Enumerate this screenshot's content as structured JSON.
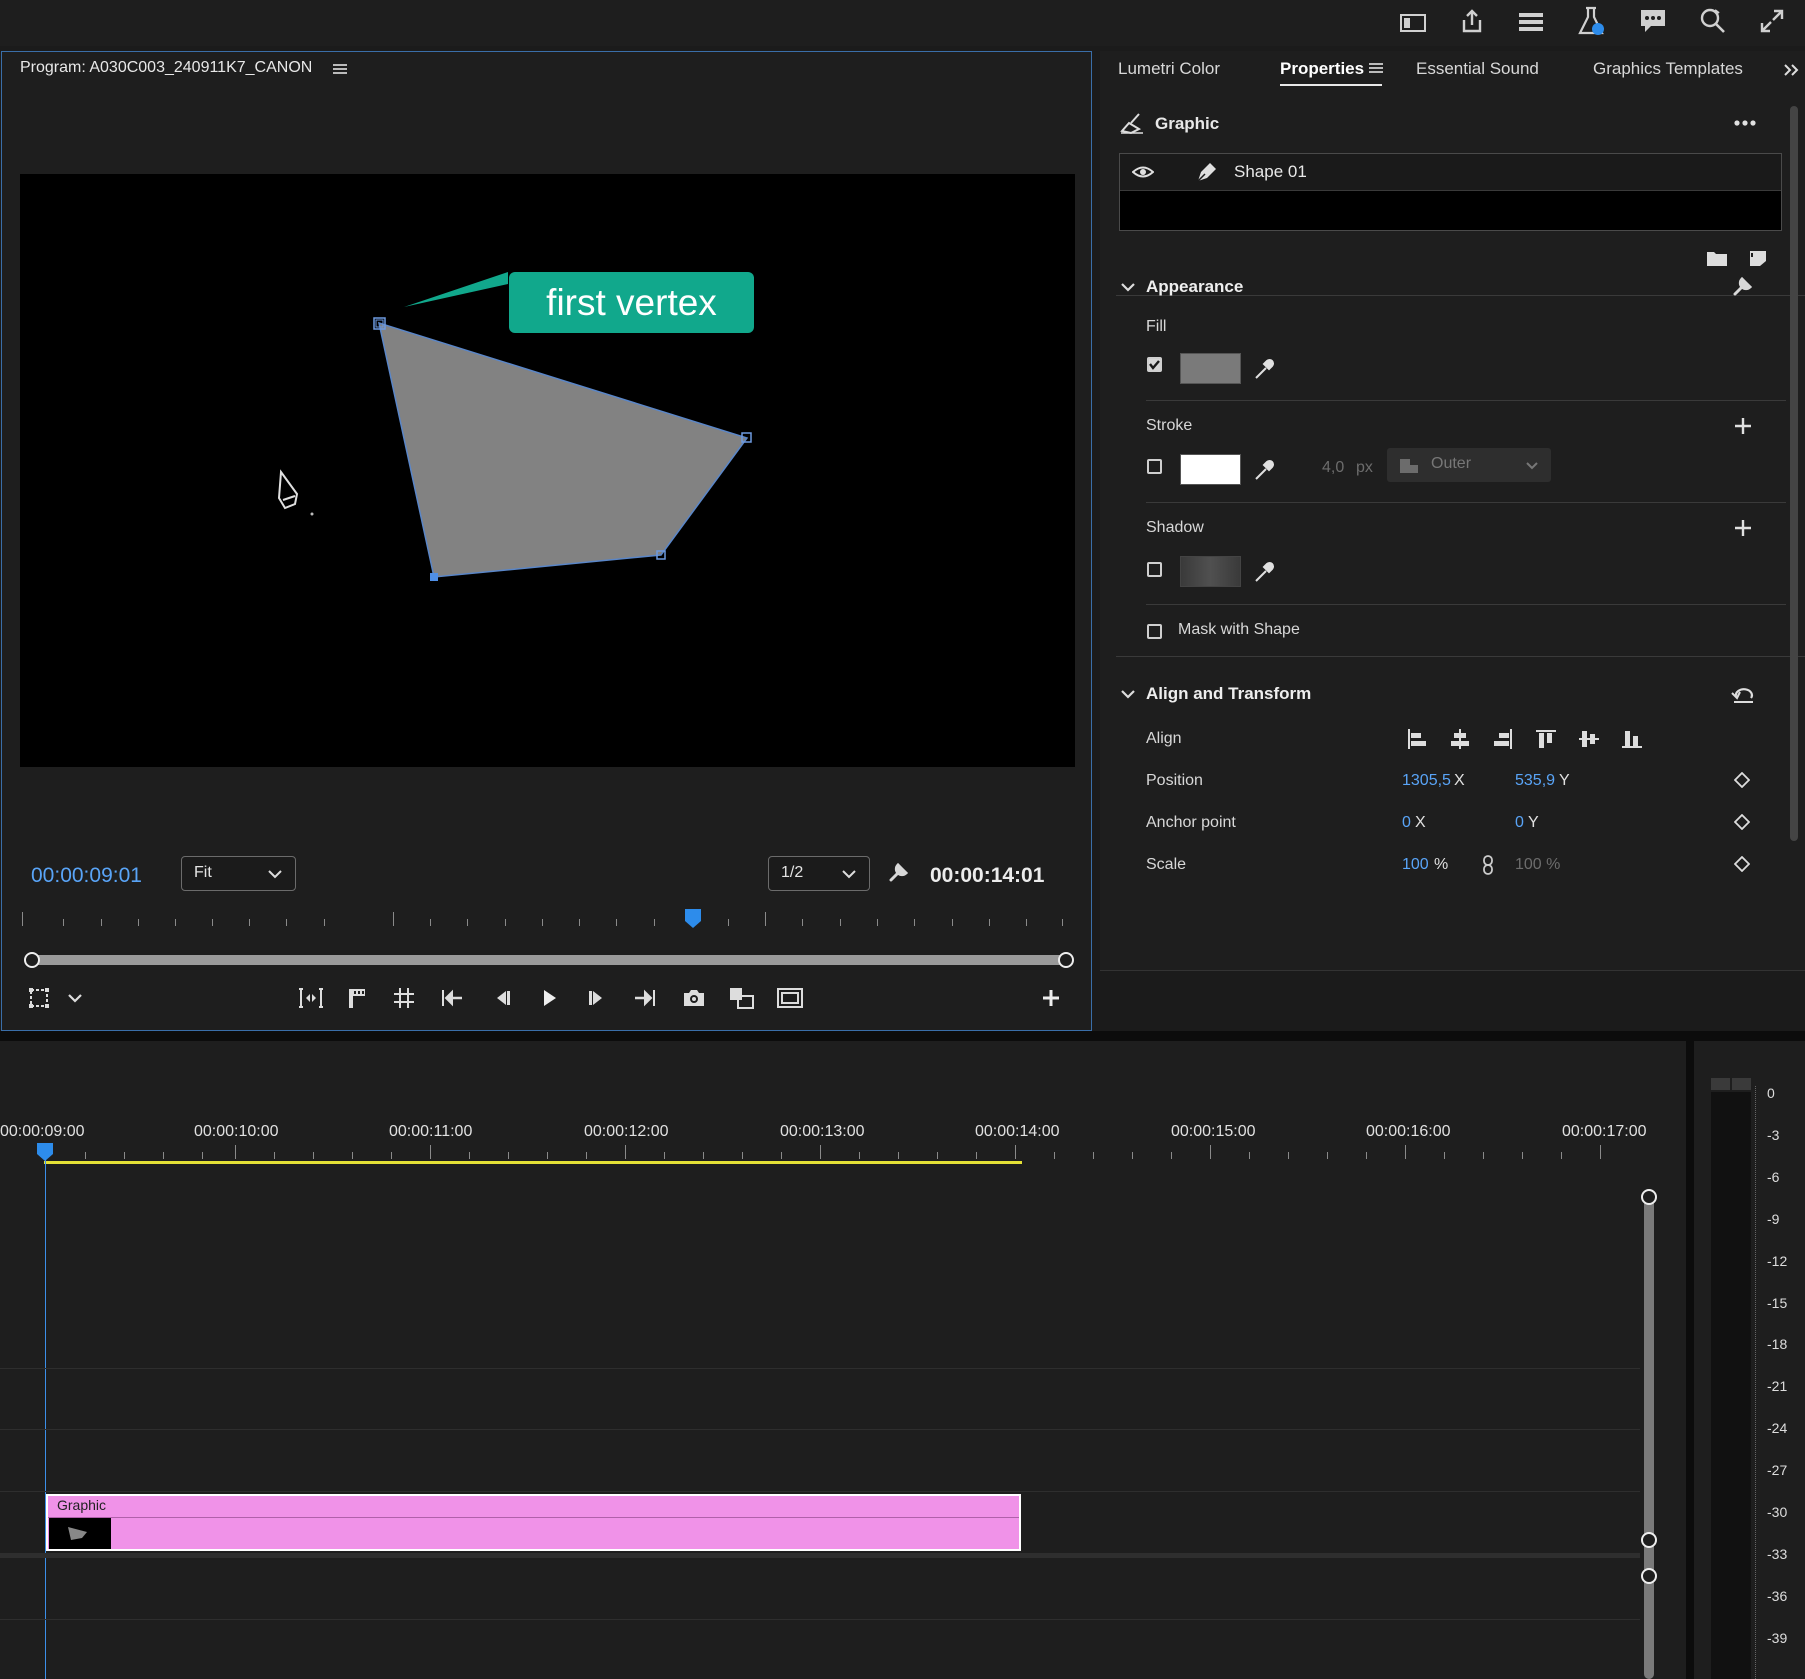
{
  "topbar": {
    "icons": [
      "panel-icon",
      "share-icon",
      "workspaces-icon",
      "beta-icon",
      "feedback-icon",
      "search-zoom-icon",
      "fullscreen-icon"
    ]
  },
  "program": {
    "title": "Program: A030C003_240911K7_CANON",
    "callout": "first vertex",
    "timecode_current": "00:00:09:01",
    "fit_label": "Fit",
    "resolution_label": "1/2",
    "timecode_duration": "00:00:14:01"
  },
  "properties": {
    "tabs": [
      {
        "label": "Lumetri Color"
      },
      {
        "label": "Properties"
      },
      {
        "label": "Essential Sound"
      },
      {
        "label": "Graphics Templates"
      }
    ],
    "graphic_label": "Graphic",
    "layer_name": "Shape 01",
    "appearance": {
      "header": "Appearance",
      "fill_label": "Fill",
      "fill_color": "#7a7a7a",
      "stroke_label": "Stroke",
      "stroke_color": "#ffffff",
      "stroke_width": "4,0",
      "stroke_unit": "px",
      "stroke_type": "Outer",
      "shadow_label": "Shadow",
      "mask_label": "Mask with Shape"
    },
    "align_transform": {
      "header": "Align and Transform",
      "align_label": "Align",
      "position_label": "Position",
      "position_x": "1305,5",
      "position_x_axis": "X",
      "position_y": "535,9",
      "position_y_axis": "Y",
      "anchor_label": "Anchor point",
      "anchor_x": "0",
      "anchor_x_axis": "X",
      "anchor_y": "0",
      "anchor_y_axis": "Y",
      "scale_label": "Scale",
      "scale_value": "100",
      "scale_unit": "%",
      "scale_linked": "100 %"
    }
  },
  "timeline": {
    "timecodes": [
      "00:00:09:00",
      "00:00:10:00",
      "00:00:11:00",
      "00:00:12:00",
      "00:00:13:00",
      "00:00:14:00",
      "00:00:15:00",
      "00:00:16:00",
      "00:00:17:00"
    ],
    "clip_label": "Graphic",
    "clip_color": "#f092e8"
  },
  "meter": {
    "labels": [
      "0",
      "-3",
      "-6",
      "-9",
      "-12",
      "-15",
      "-18",
      "-21",
      "-24",
      "-27",
      "-30",
      "-33",
      "-36",
      "-39"
    ]
  }
}
